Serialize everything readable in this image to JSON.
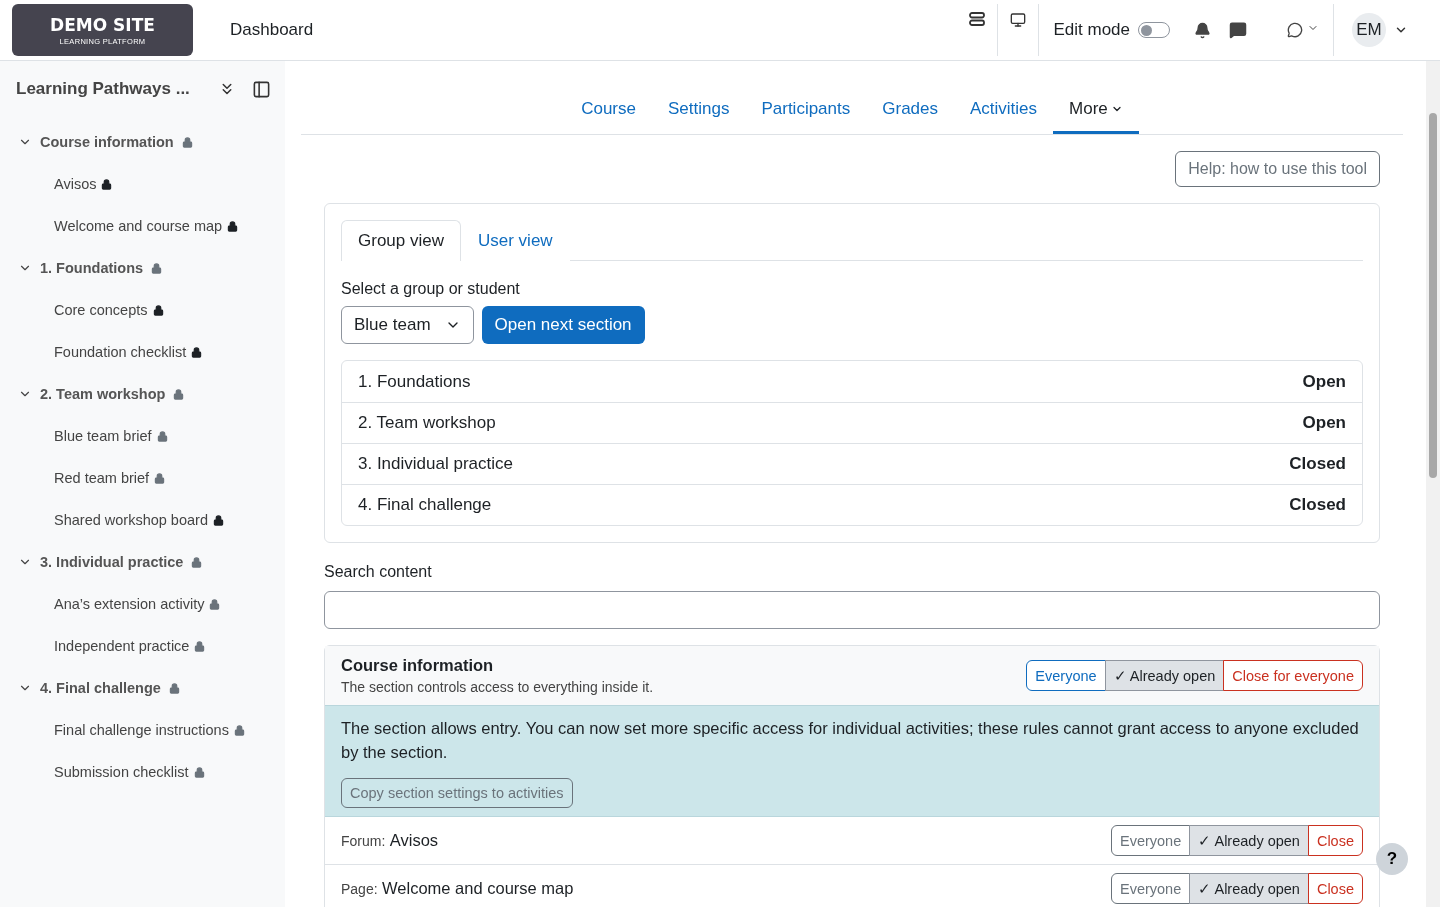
{
  "header": {
    "logo": {
      "title": "DEMO SITE",
      "subtitle": "LEARNING PLATFORM"
    },
    "nav_link": "Dashboard",
    "edit_mode": {
      "label": "Edit mode",
      "on": false
    },
    "avatar": "EM"
  },
  "sidebar": {
    "title": "Learning Pathways ...",
    "sections": [
      {
        "label": "Course information",
        "expanded": true,
        "children": [
          {
            "label": "Avisos",
            "restricted": true
          },
          {
            "label": "Welcome and course map",
            "restricted": true
          }
        ]
      },
      {
        "label": "1. Foundations",
        "expanded": true,
        "children": [
          {
            "label": "Core concepts",
            "restricted": true
          },
          {
            "label": "Foundation checklist",
            "restricted": true
          }
        ]
      },
      {
        "label": "2. Team workshop",
        "expanded": true,
        "children": [
          {
            "label": "Blue team brief",
            "restricted": false
          },
          {
            "label": "Red team brief",
            "restricted": false
          },
          {
            "label": "Shared workshop board",
            "restricted": true
          }
        ]
      },
      {
        "label": "3. Individual practice",
        "expanded": true,
        "children": [
          {
            "label": "Ana’s extension activity",
            "restricted": false
          },
          {
            "label": "Independent practice",
            "restricted": false
          }
        ]
      },
      {
        "label": "4. Final challenge",
        "expanded": true,
        "children": [
          {
            "label": "Final challenge instructions",
            "restricted": false
          },
          {
            "label": "Submission checklist",
            "restricted": false
          }
        ]
      }
    ]
  },
  "course_nav": [
    {
      "label": "Course",
      "selected": false
    },
    {
      "label": "Settings",
      "selected": false
    },
    {
      "label": "Participants",
      "selected": false
    },
    {
      "label": "Grades",
      "selected": false
    },
    {
      "label": "Activities",
      "selected": false
    },
    {
      "label": "More",
      "selected": true
    }
  ],
  "help_button": "Help: how to use this tool",
  "view_tabs": [
    {
      "label": "Group view",
      "selected": true
    },
    {
      "label": "User view",
      "selected": false
    }
  ],
  "group_select": {
    "label": "Select a group or student",
    "value": "Blue team"
  },
  "open_next_button": "Open next section",
  "sections_status": [
    {
      "name": "1. Foundations",
      "status": "Open"
    },
    {
      "name": "2. Team workshop",
      "status": "Open"
    },
    {
      "name": "3. Individual practice",
      "status": "Closed"
    },
    {
      "name": "4. Final challenge",
      "status": "Closed"
    }
  ],
  "search": {
    "label": "Search content"
  },
  "course_information": {
    "title": "Course information",
    "description": "The section controls access to everything inside it.",
    "options": [
      {
        "label": "Everyone",
        "kind": "primary",
        "selected": false
      },
      {
        "label": "✓ Already open",
        "kind": "neutral",
        "selected": true
      },
      {
        "label": "Close for everyone",
        "kind": "danger",
        "selected": false
      }
    ],
    "notice": "The section allows entry. You can now set more specific access for individual activities; these rules cannot grant access to anyone excluded by the section.",
    "copy_button": "Copy section settings to activities"
  },
  "activities": [
    {
      "type": "Forum:",
      "name": "Avisos",
      "options": [
        {
          "label": "Everyone",
          "kind": "neutral",
          "selected": false
        },
        {
          "label": "✓ Already open",
          "kind": "neutral",
          "selected": true
        },
        {
          "label": "Close",
          "kind": "danger",
          "selected": false
        }
      ]
    },
    {
      "type": "Page:",
      "name": "Welcome and course map",
      "options": [
        {
          "label": "Everyone",
          "kind": "neutral",
          "selected": false
        },
        {
          "label": "✓ Already open",
          "kind": "neutral",
          "selected": true
        },
        {
          "label": "Close",
          "kind": "danger",
          "selected": false
        }
      ]
    }
  ],
  "help_fab": "?"
}
